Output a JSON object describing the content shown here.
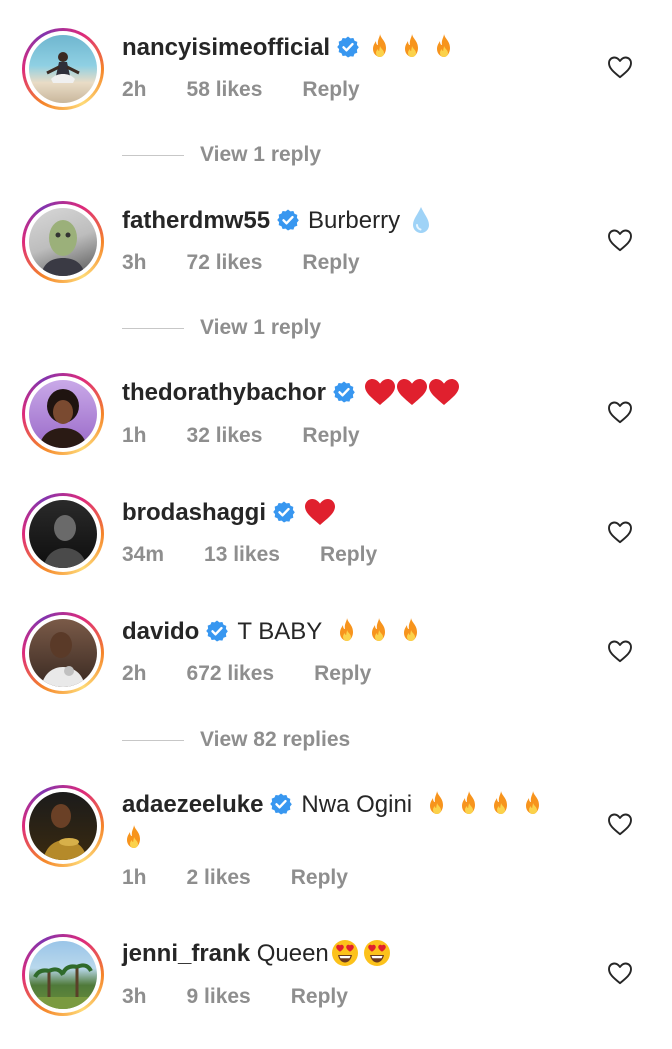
{
  "comments": [
    {
      "username": "nancyisimeofficial",
      "text": "",
      "emoji": [
        "fire",
        "fire",
        "fire"
      ],
      "time": "2h",
      "likes": "58 likes",
      "reply": "Reply",
      "view_replies": "View 1 reply"
    },
    {
      "username": "fatherdmw55",
      "text": "Burberry",
      "emoji": [
        "droplet"
      ],
      "time": "3h",
      "likes": "72 likes",
      "reply": "Reply",
      "view_replies": "View 1 reply"
    },
    {
      "username": "thedorathybachor",
      "text": "",
      "emoji": [
        "heart",
        "heart",
        "heart"
      ],
      "time": "1h",
      "likes": "32 likes",
      "reply": "Reply"
    },
    {
      "username": "brodashaggi",
      "text": "",
      "emoji": [
        "heart"
      ],
      "time": "34m",
      "likes": "13 likes",
      "reply": "Reply"
    },
    {
      "username": "davido",
      "text": "T BABY",
      "emoji": [
        "fire",
        "fire",
        "fire"
      ],
      "time": "2h",
      "likes": "672 likes",
      "reply": "Reply",
      "view_replies": "View 82 replies"
    },
    {
      "username": "adaezeeluke",
      "text": "Nwa Ogini",
      "emoji": [
        "fire",
        "fire",
        "fire",
        "fire",
        "fire"
      ],
      "time": "1h",
      "likes": "2 likes",
      "reply": "Reply"
    },
    {
      "username": "jenni_frank",
      "text": "Queen",
      "emoji": [
        "heart-eyes",
        "heart-eyes"
      ],
      "time": "3h",
      "likes": "9 likes",
      "reply": "Reply"
    }
  ],
  "colors": {
    "verified": "#3897f0",
    "meta": "#8e8e8e",
    "fire": "#f7941d",
    "heart": "#e0202e"
  }
}
